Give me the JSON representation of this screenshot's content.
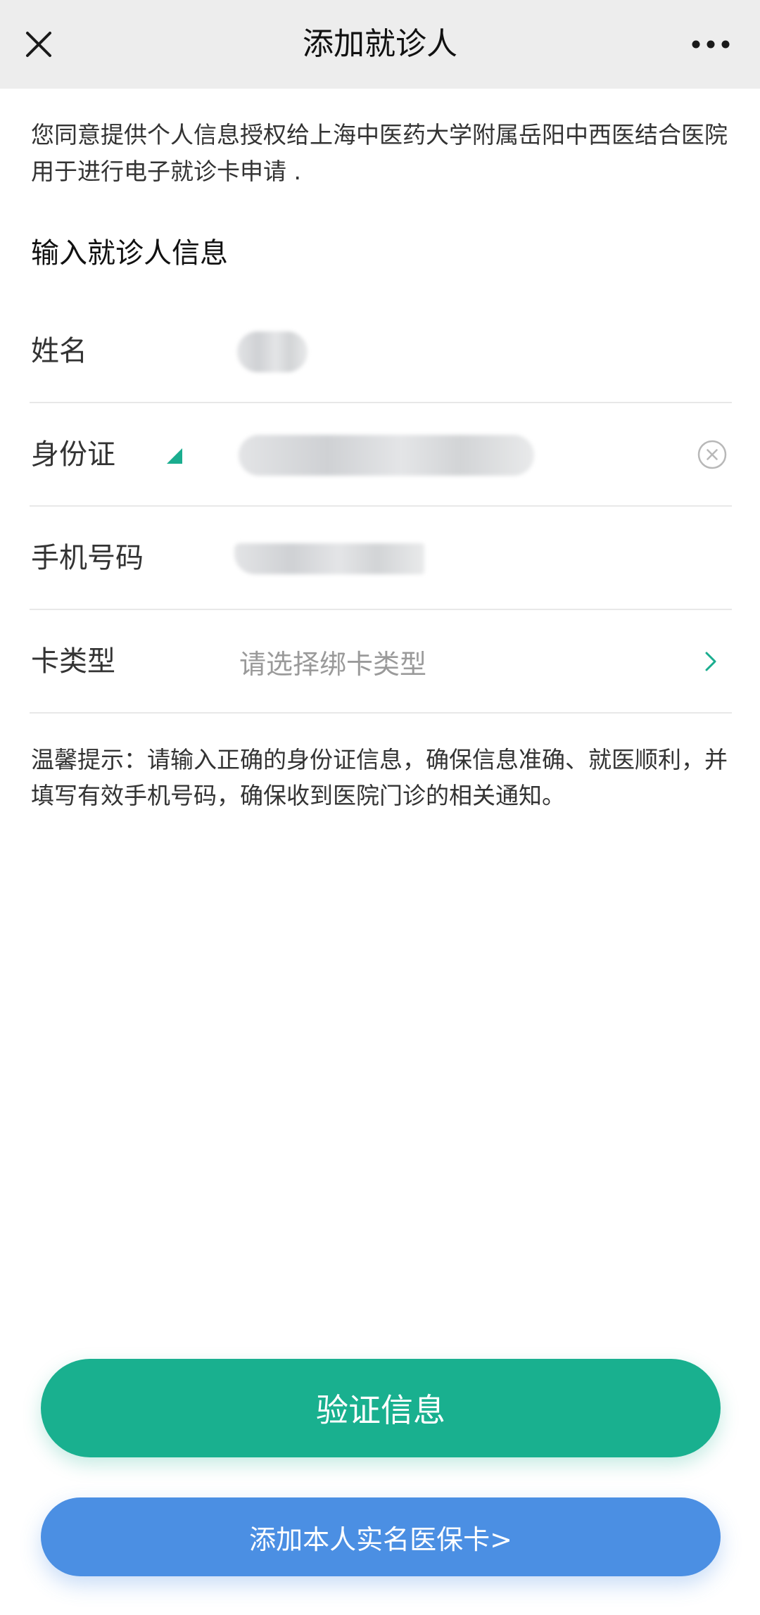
{
  "navbar": {
    "title": "添加就诊人",
    "close_icon": "close-icon",
    "more_icon": "more-icon"
  },
  "consent_text": "您同意提供个人信息授权给上海中医药大学附属岳阳中西医结合医院用于进行电子就诊卡申请 .",
  "form": {
    "section_title": "输入就诊人信息",
    "name_label": "姓名",
    "id_label": "身份证",
    "phone_label": "手机号码",
    "card_type_label": "卡类型",
    "card_type_placeholder": "请选择绑卡类型"
  },
  "tip_text": "温馨提示：请输入正确的身份证信息，确保信息准确、就医顺利，并填写有效手机号码，确保收到医院门诊的相关通知。",
  "buttons": {
    "verify_label": "验证信息",
    "insurance_label": "添加本人实名医保卡>"
  },
  "colors": {
    "primary_green": "#19b08f",
    "primary_blue": "#4b8fe3",
    "navbar_bg": "#ededed",
    "placeholder_gray": "#9a9a9a"
  }
}
